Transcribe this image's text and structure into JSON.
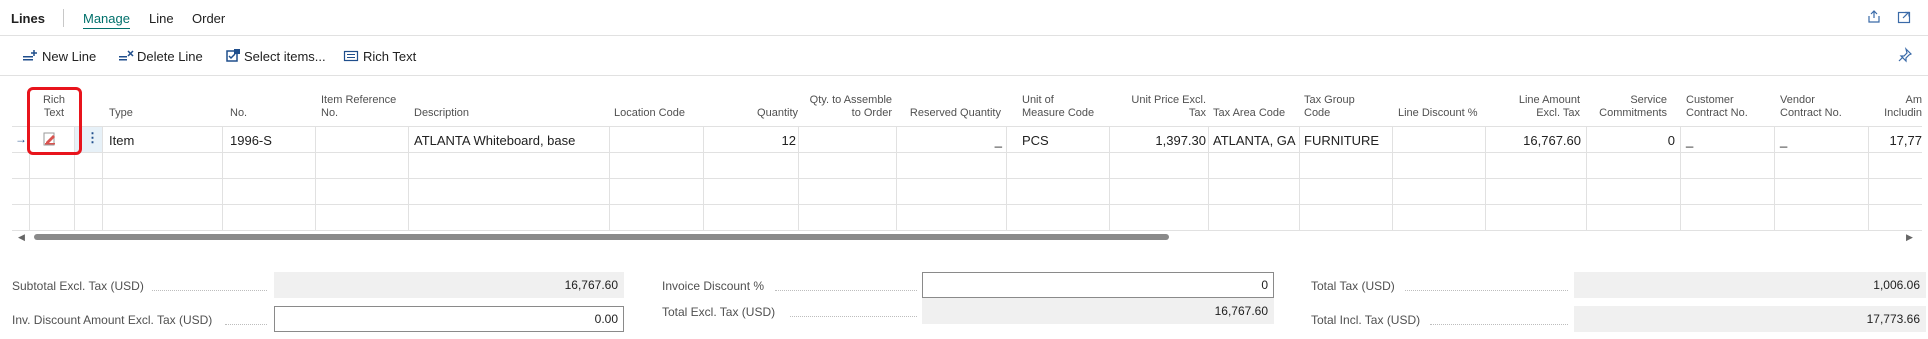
{
  "header": {
    "title": "Lines",
    "tabs": [
      {
        "label": "Manage",
        "active": true
      },
      {
        "label": "Line",
        "active": false
      },
      {
        "label": "Order",
        "active": false
      }
    ],
    "right_icons": [
      "share-icon",
      "popout-icon"
    ]
  },
  "actions": {
    "new_line": "New Line",
    "delete_line": "Delete Line",
    "select_items": "Select items...",
    "rich_text": "Rich Text"
  },
  "columns": {
    "rich_text_1": "Rich",
    "rich_text_2": "Text",
    "type": "Type",
    "no": "No.",
    "item_ref_1": "Item Reference",
    "item_ref_2": "No.",
    "description": "Description",
    "location": "Location Code",
    "quantity": "Quantity",
    "qty_assemble_1": "Qty. to Assemble",
    "qty_assemble_2": "to Order",
    "reserved": "Reserved Quantity",
    "uom_1": "Unit of",
    "uom_2": "Measure Code",
    "unit_price_1": "Unit Price Excl.",
    "unit_price_2": "Tax",
    "tax_area": "Tax Area Code",
    "tax_group_1": "Tax Group",
    "tax_group_2": "Code",
    "line_discount": "Line Discount %",
    "line_amount_1": "Line Amount",
    "line_amount_2": "Excl. Tax",
    "service_1": "Service",
    "service_2": "Commitments",
    "customer_1": "Customer",
    "customer_2": "Contract No.",
    "vendor_1": "Vendor",
    "vendor_2": "Contract No.",
    "amount_incl_1": "Am",
    "amount_incl_2": "Includin"
  },
  "row": {
    "type": "Item",
    "no": "1996-S",
    "description": "ATLANTA Whiteboard, base",
    "quantity": "12",
    "reserved": "_",
    "uom": "PCS",
    "unit_price": "1,397.30",
    "tax_area": "ATLANTA, GA",
    "tax_group": "FURNITURE",
    "line_amount": "16,767.60",
    "service": "0",
    "customer": "_",
    "vendor": "_",
    "amount_incl": "17,77"
  },
  "totals": {
    "subtotal_label": "Subtotal Excl. Tax (USD)",
    "subtotal_value": "16,767.60",
    "inv_discount_amount_label": "Inv. Discount Amount Excl. Tax (USD)",
    "inv_discount_amount_value": "0.00",
    "invoice_discount_pct_label": "Invoice Discount %",
    "invoice_discount_pct_value": "0",
    "total_excl_label": "Total Excl. Tax (USD)",
    "total_excl_value": "16,767.60",
    "total_tax_label": "Total Tax (USD)",
    "total_tax_value": "1,006.06",
    "total_incl_label": "Total Incl. Tax (USD)",
    "total_incl_value": "17,773.66"
  },
  "colors": {
    "accent": "#00706b",
    "highlight": "#e8141c"
  }
}
